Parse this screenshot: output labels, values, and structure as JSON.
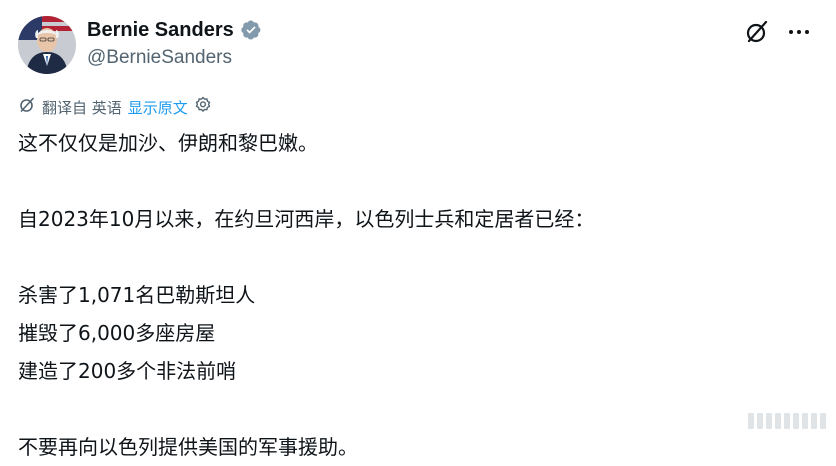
{
  "author": {
    "display_name": "Bernie Sanders",
    "handle": "@BernieSanders",
    "verified": true
  },
  "icons": {
    "verified": "verified-badge-icon",
    "grok": "grok-icon",
    "more": "more-icon",
    "translate": "grok-icon",
    "settings": "gear-icon"
  },
  "colors": {
    "text": "#0f1419",
    "secondary": "#536471",
    "link": "#1d9bf0",
    "verified_badge": "#829aab"
  },
  "translation": {
    "label": "翻译自 英语",
    "show_original": "显示原文"
  },
  "tweet": {
    "lines": [
      "这不仅仅是加沙、伊朗和黎巴嫩。",
      "",
      "自2023年10月以来，在约旦河西岸，以色列士兵和定居者已经：",
      "",
      "杀害了1,071名巴勒斯坦人",
      "摧毁了6,000多座房屋",
      "建造了200多个非法前哨",
      "",
      "不要再向以色列提供美国的军事援助。"
    ]
  }
}
